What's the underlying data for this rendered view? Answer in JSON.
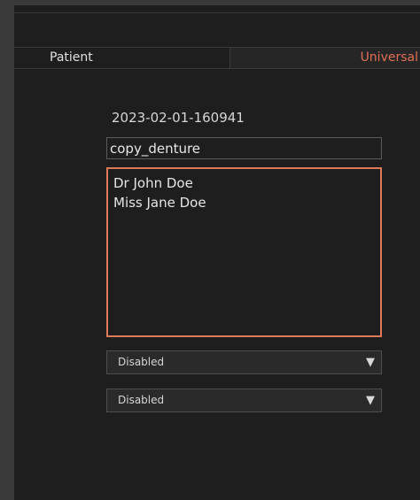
{
  "tabs": [
    {
      "label": "Patient",
      "active": false
    },
    {
      "label": "Universal",
      "active": true
    }
  ],
  "form": {
    "case_id": "2023-02-01-160941",
    "case_name": "copy_denture",
    "names": [
      "Dr John Doe",
      "Miss Jane Doe"
    ],
    "dropdown_1": {
      "value": "Disabled"
    },
    "dropdown_2": {
      "value": "Disabled"
    }
  },
  "icons": {
    "dropdown_arrow": "▼"
  },
  "colors": {
    "accent": "#e07b59",
    "background": "#1e1e1e",
    "gutter": "#3a3a3a"
  }
}
